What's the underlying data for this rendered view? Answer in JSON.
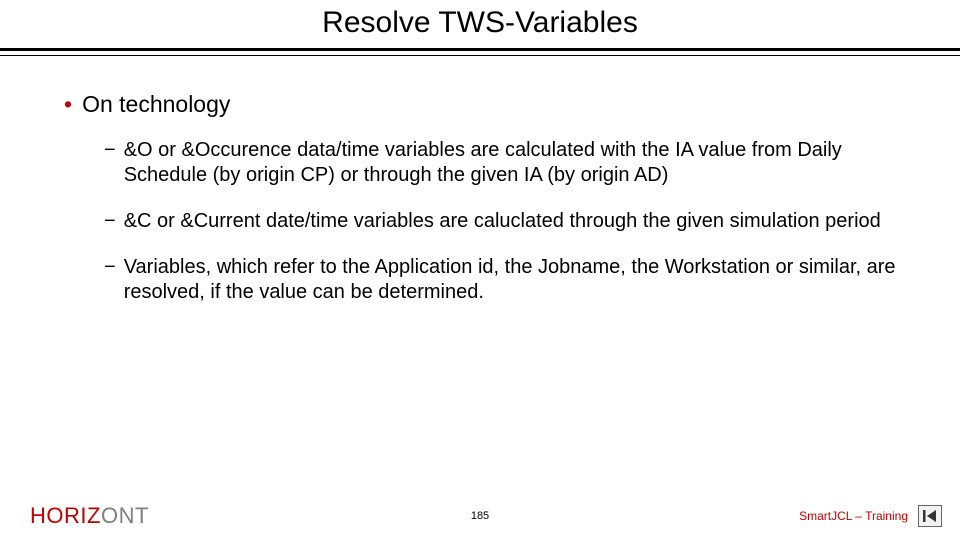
{
  "title": "Resolve TWS-Variables",
  "bullet": {
    "heading": "On technology",
    "subs": [
      "&O or &Occurence data/time variables are calculated with the IA value from Daily Schedule (by origin CP) or through the given IA (by origin AD)",
      "&C or &Current date/time variables are caluclated through the given simulation period",
      "Variables, which refer to the Application id, the Jobname, the Workstation or similar, are resolved, if the value can be determined."
    ]
  },
  "footer": {
    "brand_left": "HORIZ",
    "brand_right": "ONT",
    "page": "185",
    "course": "SmartJCL – Training",
    "nav_icon": "skip-previous-icon"
  }
}
